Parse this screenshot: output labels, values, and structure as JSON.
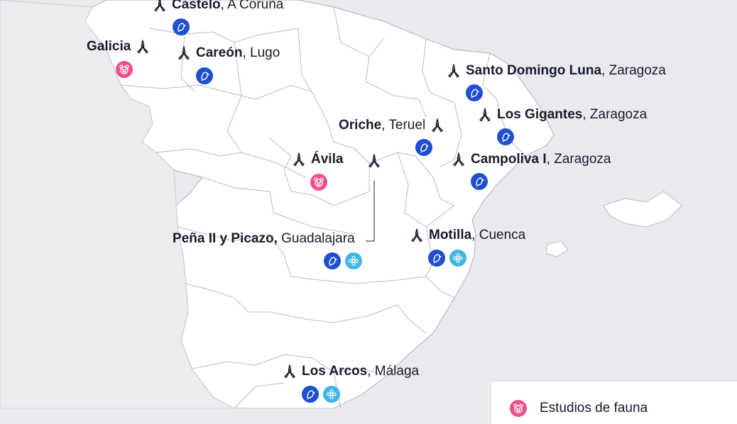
{
  "sites": [
    {
      "id": "castelo",
      "name": "Castelo",
      "region": ", A Coruña",
      "badges": [
        "bird"
      ]
    },
    {
      "id": "galicia",
      "name": "Galicia",
      "region": "",
      "badges": [
        "mammal"
      ]
    },
    {
      "id": "careon",
      "name": "Careón",
      "region": ", Lugo",
      "badges": [
        "bird"
      ]
    },
    {
      "id": "santo-domingo",
      "name": "Santo Domingo Luna",
      "region": ", Zaragoza",
      "badges": [
        "bird"
      ]
    },
    {
      "id": "los-gigantes",
      "name": "Los Gigantes",
      "region": ", Zaragoza",
      "badges": [
        "bird"
      ]
    },
    {
      "id": "oriche",
      "name": "Oriche",
      "region": ", Teruel",
      "badges": [
        "bird"
      ]
    },
    {
      "id": "campoliva",
      "name": "Campoliva I",
      "region": ", Zaragoza",
      "badges": [
        "bird"
      ]
    },
    {
      "id": "avila",
      "name": "Ávila",
      "region": "",
      "badges": [
        "mammal"
      ]
    },
    {
      "id": "pena",
      "name": "Peña II y Picazo,",
      "region": " Guadalajara",
      "badges": [
        "bird",
        "flower"
      ]
    },
    {
      "id": "motilla",
      "name": "Motilla",
      "region": ", Cuenca",
      "badges": [
        "bird",
        "flower"
      ]
    },
    {
      "id": "los-arcos",
      "name": "Los Arcos",
      "region": ", Málaga",
      "badges": [
        "bird",
        "flower"
      ]
    }
  ],
  "legend": {
    "items": [
      {
        "label": "Estudios de fauna",
        "badge": "mammal"
      }
    ]
  },
  "colors": {
    "background": "#e9eaee",
    "land": "#ffffff",
    "borders": "#b9bcc6",
    "bird_badge": "#1f4fd1",
    "flower_badge": "#3fb6e6",
    "mammal_badge": "#ee4f8e"
  },
  "icons": {
    "turbine": "wind-turbine-icon",
    "bird": "bird-icon",
    "flower": "flower-icon",
    "mammal": "bear-face-icon"
  }
}
